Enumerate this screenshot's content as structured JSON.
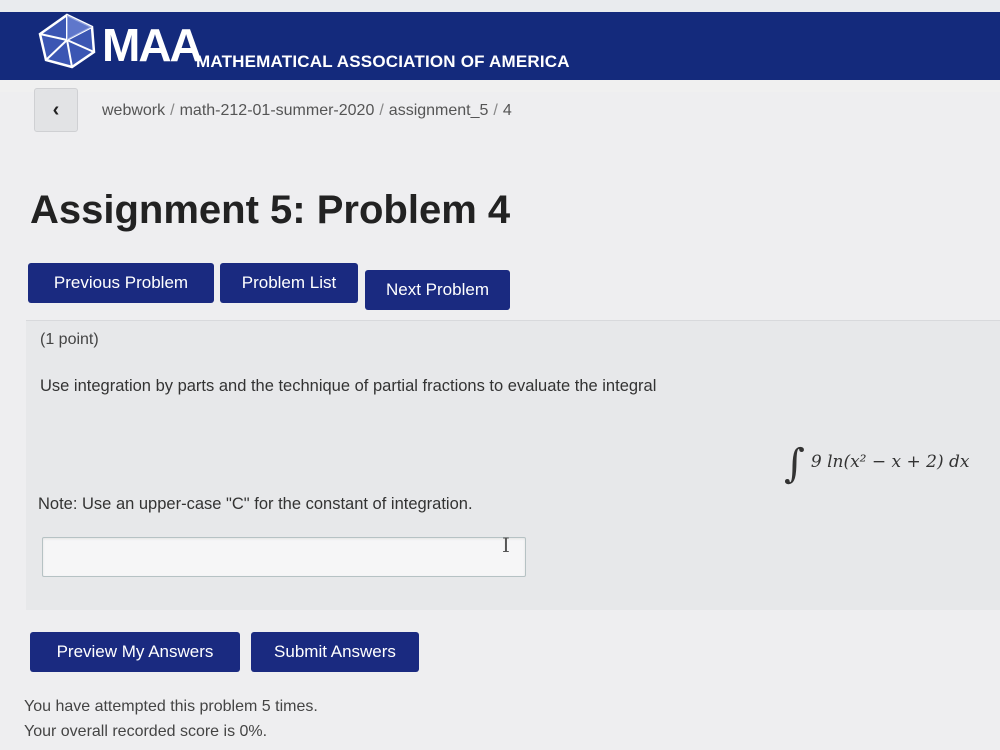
{
  "header": {
    "logo_text": "MAA",
    "org_name": "MATHEMATICAL ASSOCIATION OF AMERICA",
    "band_color": "#142a7c"
  },
  "breadcrumb": {
    "back_icon": "chevron-left-icon",
    "items": [
      "webwork",
      "math-212-01-summer-2020",
      "assignment_5",
      "4"
    ]
  },
  "page": {
    "title": "Assignment 5: Problem 4"
  },
  "nav": {
    "previous": "Previous Problem",
    "list": "Problem List",
    "next": "Next Problem"
  },
  "problem": {
    "points": "(1 point)",
    "question": "Use integration by parts and the technique of partial fractions to evaluate the integral",
    "integral_sign": "∫",
    "integral_expr": "9 ln(x² − x + 2) dx",
    "note": "Note: Use an upper-case \"C\" for the constant of integration.",
    "answer_value": "",
    "cursor_icon": "text-cursor-icon"
  },
  "actions": {
    "preview": "Preview My Answers",
    "submit": "Submit Answers"
  },
  "status": {
    "attempts": "You have attempted this problem 5 times.",
    "score": "Your overall recorded score is 0%."
  }
}
